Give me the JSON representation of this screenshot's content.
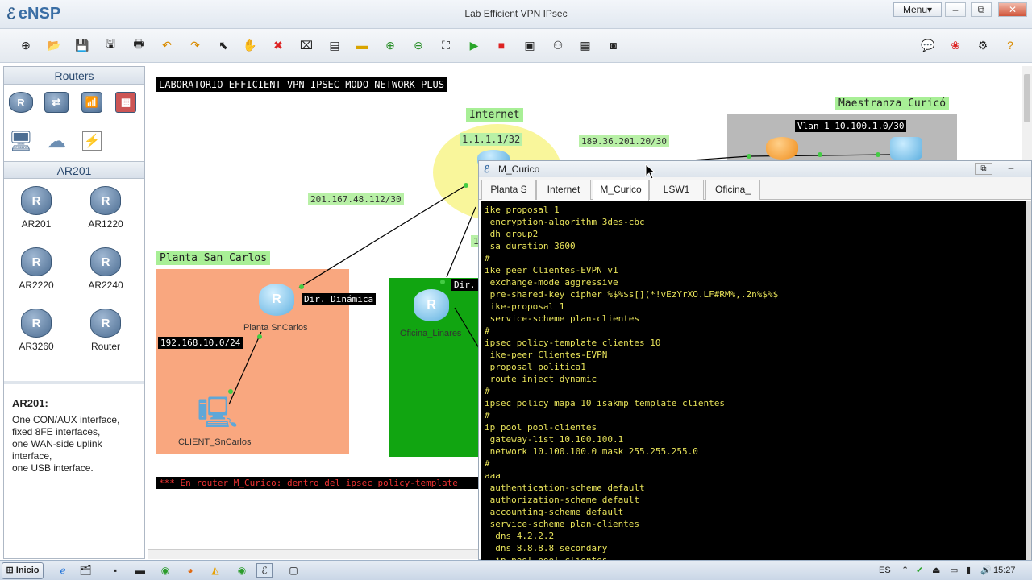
{
  "app": {
    "name": "eNSP",
    "window_title": "Lab Efficient VPN IPsec",
    "menu_label": "Menu",
    "min": "–",
    "restore": "⧉",
    "close": "✕"
  },
  "toolbar": {
    "icons": [
      "new-topo-icon",
      "open-icon",
      "save-icon",
      "save-as-icon",
      "print-icon",
      "undo-icon",
      "redo-icon",
      "select-icon",
      "pan-hand-icon",
      "delete-icon",
      "delete-link-icon",
      "text-icon",
      "palette-icon",
      "zoom-in-icon",
      "zoom-out-icon",
      "fit-icon",
      "start-icon",
      "stop-icon",
      "capture-icon",
      "topology-icon",
      "grid-icon",
      "screenshot-icon"
    ],
    "right_icons": [
      "chat-icon",
      "huawei-icon",
      "settings-icon",
      "help-icon"
    ]
  },
  "left_panel": {
    "routers_header": "Routers",
    "ar201_header": "AR201",
    "devices": [
      {
        "label": "AR201"
      },
      {
        "label": "AR1220"
      },
      {
        "label": "AR2220"
      },
      {
        "label": "AR2240"
      },
      {
        "label": "AR3260"
      },
      {
        "label": "Router"
      }
    ],
    "info_title": "AR201:",
    "info_lines": [
      "One CON/AUX interface,",
      "fixed 8FE interfaces,",
      "one WAN-side uplink",
      "interface,",
      "one USB interface."
    ]
  },
  "canvas": {
    "banner": "LABORATORIO EFFICIENT VPN IPSEC MODO NETWORK PLUS",
    "internet_label": "Internet",
    "internet_ip": "1.1.1.1/32",
    "link_curico": "189.36.201.20/30",
    "maestranza_label": "Maestranza Curicó",
    "vlan_label": "Vlan 1 10.100.1.0/30",
    "link_sancarlos": "201.167.48.112/30",
    "planta_label": "Planta San Carlos",
    "dir_dinamica": "Dir. Dinámica",
    "dir_partial": "Dir.",
    "planta_router": "Planta SnCarlos",
    "oficina_router": "Oficina_Linares",
    "lan_sancarlos": "192.168.10.0/24",
    "client_label": "CLIENT_SnCarlos",
    "note": "*** En router M_Curico: dentro del ipsec policy-template",
    "partial_1": "1"
  },
  "console": {
    "title": "M_Curico",
    "tabs": [
      {
        "label": "Planta S"
      },
      {
        "label": "Internet"
      },
      {
        "label": "M_Curico",
        "active": true
      },
      {
        "label": "LSW1"
      },
      {
        "label": "Oficina_"
      }
    ],
    "lines": [
      "ike proposal 1",
      " encryption-algorithm 3des-cbc",
      " dh group2",
      " sa duration 3600",
      "#",
      "ike peer Clientes-EVPN v1",
      " exchange-mode aggressive",
      " pre-shared-key cipher %$%$s[](*!vEzYrXO.LF#RM%,.2n%$%$",
      " ike-proposal 1",
      " service-scheme plan-clientes",
      "#",
      "ipsec policy-template clientes 10",
      " ike-peer Clientes-EVPN",
      " proposal politica1",
      " route inject dynamic",
      "#",
      "ipsec policy mapa 10 isakmp template clientes",
      "#",
      "ip pool pool-clientes",
      " gateway-list 10.100.100.1",
      " network 10.100.100.0 mask 255.255.255.0",
      "#",
      "aaa",
      " authentication-scheme default",
      " authorization-scheme default",
      " accounting-scheme default",
      " service-scheme plan-clientes",
      "  dns 4.2.2.2",
      "  dns 8.8.8.8 secondary",
      "  ip-pool pool-clientes"
    ]
  },
  "taskbar": {
    "start": "Inicio",
    "lang": "ES",
    "time": "15:27"
  },
  "colors": {
    "planta_bg": "#f9a77f",
    "oficina_bg": "#11a511",
    "internet_glow": "#f8f58a",
    "maestranza_bg": "#b9b9b9"
  }
}
